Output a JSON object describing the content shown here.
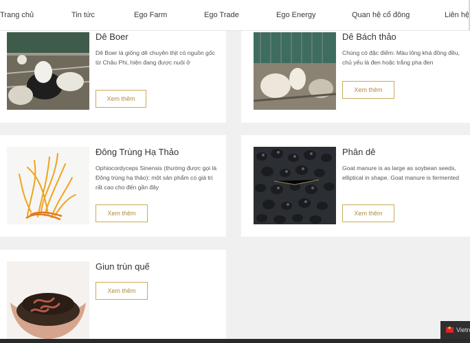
{
  "nav": {
    "items": [
      "Trang chủ",
      "Tin tức",
      "Ego Farm",
      "Ego Trade",
      "Ego Energy",
      "Quan hệ cổ đông",
      "Liên hệ"
    ]
  },
  "products": [
    {
      "title": "Dê Boer",
      "description": "Dê Boer là giống dê chuyên thịt có nguồn gốc từ Châu Phi, hiện đang được nuôi ở",
      "button": "Xem thêm",
      "image_icon": "goat-photo"
    },
    {
      "title": "Dê Bách thảo",
      "description": "Chúng có đặc điểm: Màu lông khá đồng đều, chủ yếu là đen hoặc trắng pha đen",
      "button": "Xem thêm",
      "image_icon": "goat-photo"
    },
    {
      "title": "Đông Trùng Hạ Thảo",
      "description": "Ophiocordyceps Sinensis (thường được gọi là Đông trùng hạ thảo): một sản phẩm có giá trị rất cao cho đến gần đây",
      "button": "Xem thêm",
      "image_icon": "cordyceps-photo"
    },
    {
      "title": "Phân dê",
      "description": "Goat manure is as large as soybean seeds, elliptical in shape. Goat manure is fermented",
      "button": "Xem thêm",
      "image_icon": "manure-photo"
    },
    {
      "title": "Giun trùn quế",
      "description": "",
      "button": "Xem thêm",
      "image_icon": "earthworm-photo"
    }
  ],
  "language": {
    "label": "Vietn"
  },
  "colors": {
    "accent": "#c9a95a",
    "background": "#f0f0f0"
  }
}
